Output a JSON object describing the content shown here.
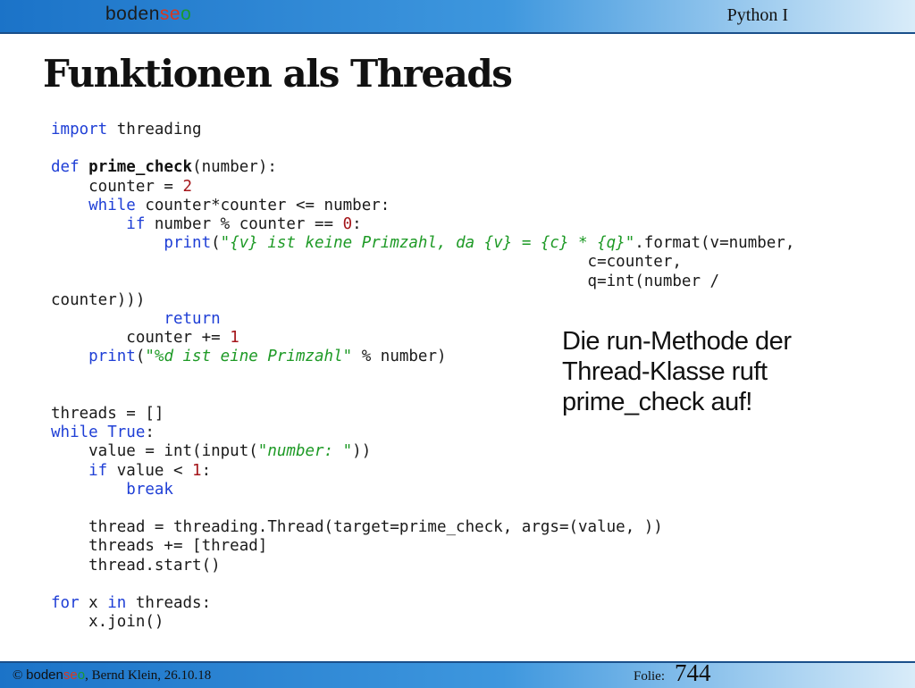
{
  "header": {
    "logo_prefix": "boden",
    "logo_s": "s",
    "logo_e": "e",
    "logo_o": "o",
    "course": "Python I"
  },
  "slide": {
    "title": "Funktionen als Threads",
    "callout": "Die run-Methode der Thread-Klasse ruft prime_check auf!"
  },
  "code": {
    "l1_kw": "import",
    "l1_rest": " threading",
    "l3_kw": "def",
    "l3_fn": "prime_check",
    "l3_rest": "(number):",
    "l4_a": "    counter = ",
    "l4_num": "2",
    "l5_kw": "    while",
    "l5_rest": " counter*counter <= number:",
    "l6_kw": "        if",
    "l6_a": " number % counter == ",
    "l6_num": "0",
    "l6_b": ":",
    "l7_kw": "            print",
    "l7_a": "(",
    "l7_str": "\"{v} ist keine Primzahl, da {v} = {c} * {q}\"",
    "l7_b": ".format(v=number,",
    "l8": "                                                         c=counter,",
    "l9": "                                                         q=int(number /",
    "l10": "counter)))",
    "l11_kw": "            return",
    "l12_a": "        counter += ",
    "l12_num": "1",
    "l13_kw": "    print",
    "l13_a": "(",
    "l13_str": "\"%d ist eine Primzahl\"",
    "l13_b": " % number)",
    "l16": "threads = []",
    "l17_kw1": "while",
    "l17_kw2": " True",
    "l17_b": ":",
    "l18_a": "    value = int(input(",
    "l18_str": "\"number: \"",
    "l18_b": "))",
    "l19_kw": "    if",
    "l19_a": " value < ",
    "l19_num": "1",
    "l19_b": ":",
    "l20_kw": "        break",
    "l22": "    thread = threading.Thread(target=prime_check, args=(value, ))",
    "l23": "    threads += [thread]",
    "l24": "    thread.start()",
    "l26_kw1": "for",
    "l26_a": " x ",
    "l26_kw2": "in",
    "l26_b": " threads:",
    "l27": "    x.join()"
  },
  "footer": {
    "copyright": "©",
    "author": ", Bernd Klein, 26.10.18",
    "folie_label": "Folie:",
    "folie_number": "744"
  }
}
